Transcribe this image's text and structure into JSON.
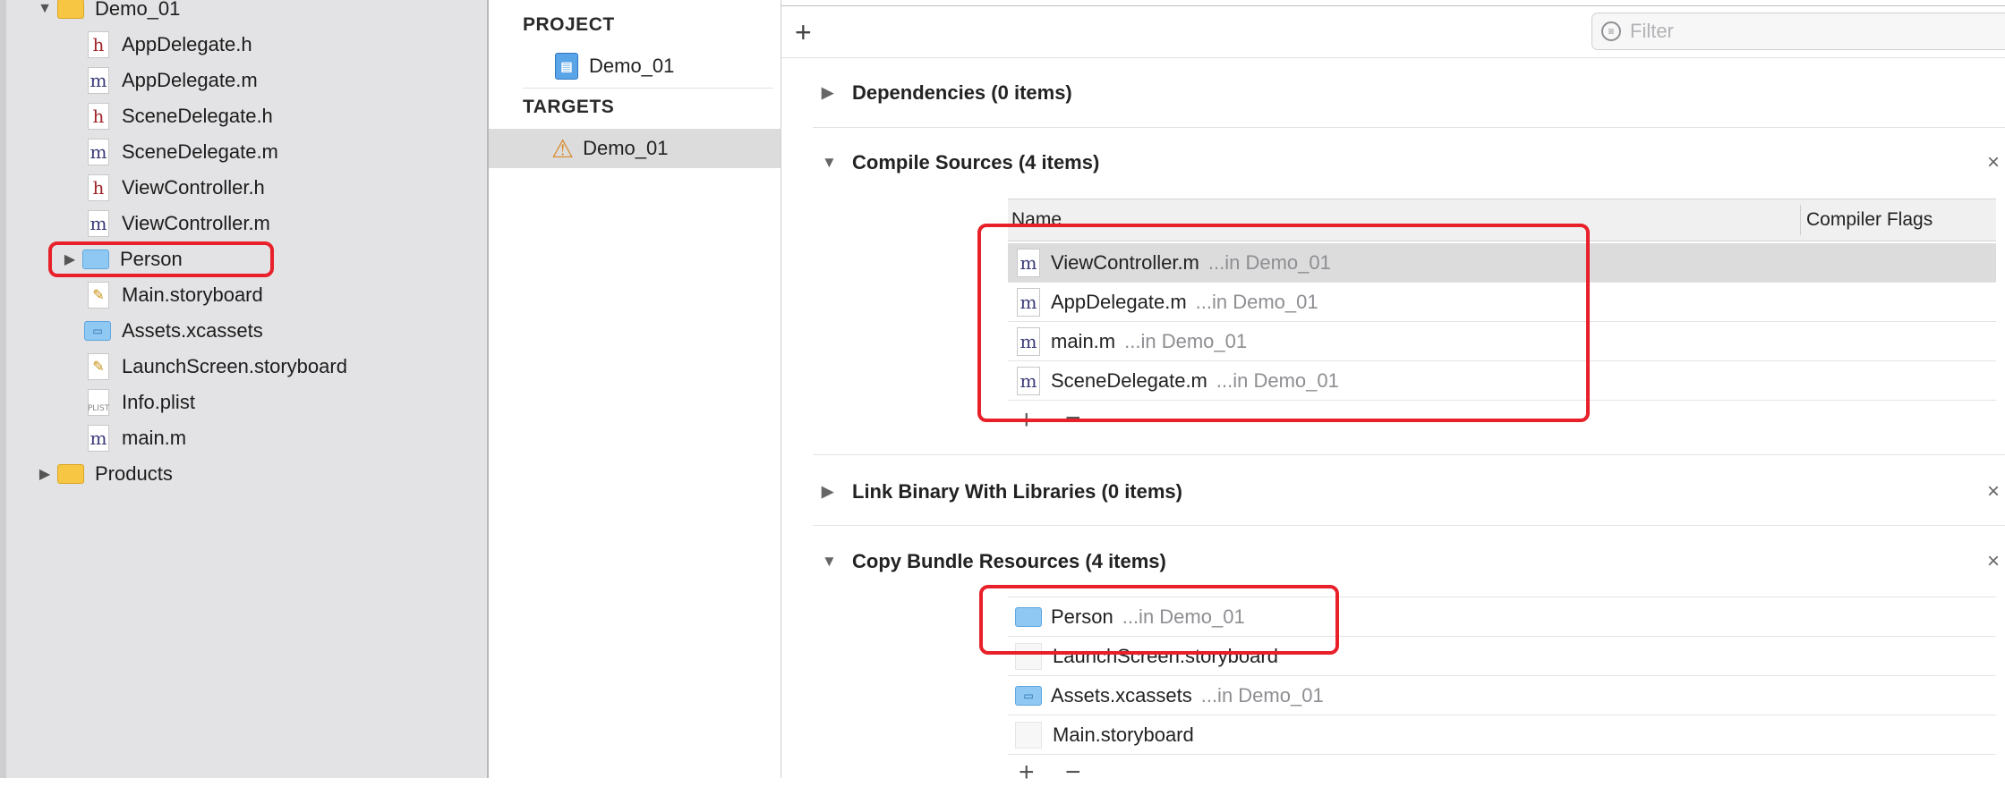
{
  "navigator": {
    "root_folder": "Demo_01",
    "files": [
      {
        "name": "AppDelegate.h",
        "kind": "h"
      },
      {
        "name": "AppDelegate.m",
        "kind": "m"
      },
      {
        "name": "SceneDelegate.h",
        "kind": "h"
      },
      {
        "name": "SceneDelegate.m",
        "kind": "m"
      },
      {
        "name": "ViewController.h",
        "kind": "h"
      },
      {
        "name": "ViewController.m",
        "kind": "m"
      },
      {
        "name": "Person",
        "kind": "folder-blue"
      },
      {
        "name": "Main.storyboard",
        "kind": "storyboard"
      },
      {
        "name": "Assets.xcassets",
        "kind": "assets"
      },
      {
        "name": "LaunchScreen.storyboard",
        "kind": "storyboard"
      },
      {
        "name": "Info.plist",
        "kind": "plist"
      },
      {
        "name": "main.m",
        "kind": "m"
      }
    ],
    "products_folder": "Products",
    "icon_letters": {
      "h": "h",
      "m": "m",
      "plist": "PLIST"
    }
  },
  "outline": {
    "project_header": "PROJECT",
    "project_name": "Demo_01",
    "targets_header": "TARGETS",
    "target_name": "Demo_01"
  },
  "toolbar": {
    "add_label": "+",
    "filter_placeholder": "Filter"
  },
  "phases": {
    "dependencies": "Dependencies (0 items)",
    "compile_sources": "Compile Sources (4 items)",
    "link_binary": "Link Binary With Libraries (0 items)",
    "copy_bundle": "Copy Bundle Resources (4 items)",
    "close_symbol": "×",
    "expanded_symbol": "▼",
    "collapsed_symbol": "▶"
  },
  "compile_table": {
    "columns": [
      "Name",
      "Compiler Flags"
    ],
    "rows": [
      {
        "name": "ViewController.m",
        "path": "...in Demo_01"
      },
      {
        "name": "AppDelegate.m",
        "path": "...in Demo_01"
      },
      {
        "name": "main.m",
        "path": "...in Demo_01"
      },
      {
        "name": "SceneDelegate.m",
        "path": "...in Demo_01"
      }
    ]
  },
  "copy_table": {
    "rows": [
      {
        "name": "Person",
        "path": "...in Demo_01"
      },
      {
        "name": "LaunchScreen.storyboard",
        "path": ""
      },
      {
        "name": "Assets.xcassets",
        "path": "...in Demo_01"
      },
      {
        "name": "Main.storyboard",
        "path": ""
      }
    ]
  },
  "controls": {
    "add": "+",
    "remove": "−"
  },
  "colors": {
    "highlight": "#e8202a",
    "selection": "#dcdcdc"
  }
}
